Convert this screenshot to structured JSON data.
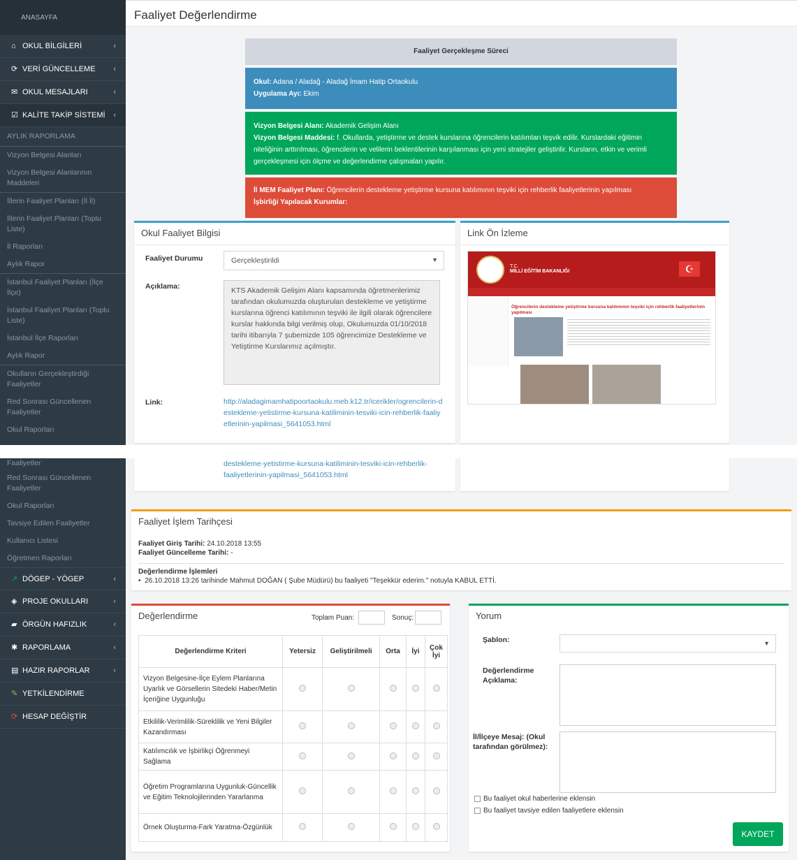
{
  "sidebar": {
    "top": "ANASAYFA",
    "menu": [
      "OKUL BİLGİLERİ",
      "VERİ GÜNCELLEME",
      "OKUL MESAJLARI",
      "KALİTE TAKİP SİSTEMİ"
    ],
    "subs": [
      "AYLIK RAPORLAMA",
      "Vizyon Belgesi Alanları",
      "Vizyon Belgesi Alanlarının Maddeleri",
      "İllerin Faaliyet Planları (İl İl)",
      "İllerin Faaliyet Planları (Toplu Liste)",
      "İl Raporları",
      "Aylık Rapor",
      "İstanbul Faaliyet Planları (İlçe İlçe)",
      "İstanbul Faaliyet Planları (Toplu Liste)",
      "İstanbul İlçe Raporları",
      "Aylık Rapor",
      "Okulların Gerçekleştirdiği Faaliyetler",
      "Red Sonrası Güncellenen Faaliyetler",
      "Okul Raporları"
    ],
    "subs2": [
      "Faaliyetler",
      "Red Sonrası Güncellenen Faaliyetler",
      "Okul Raporları",
      "Tavsiye Edilen Faaliyetler",
      "Kullanıcı Listesi",
      "Öğretmen Raporları"
    ],
    "menu2": [
      "DÖGEP - YÖGEP",
      "PROJE OKULLARI",
      "ÖRGÜN HAFIZLIK",
      "RAPORLAMA",
      "HAZIR RAPORLAR",
      "YETKİLENDİRME",
      "HESAP DEĞİŞTİR"
    ]
  },
  "page": {
    "title": "Faaliyet Değerlendirme"
  },
  "process": {
    "header": "Faaliyet Gerçekleşme Süreci",
    "okul_label": "Okul:",
    "okul": "Adana / Aladağ - Aladağ İmam Hatip Ortaokulu",
    "ay_label": "Uygulama Ayı:",
    "ay": "Ekim",
    "alan_label": "Vizyon Belgesi Alanı:",
    "alan": "Akademik Gelişim Alanı",
    "madde_label": "Vizyon Belgesi Maddesi:",
    "madde": "f. Okullarda, yetiştirme ve destek kurslarına öğrencilerin katılımları teşvik edilir. Kurslardaki eğitimin niteliğinin arttırılması, öğrencilerin ve velilerin beklentilerinin karşılanması için yeni stratejiler geliştirilir. Kursların, etkin ve verimli gerçekleşmesi için ölçme ve değerlendirme çalışmaları yapılır.",
    "plan_label": "İl MEM Faaliyet Planı:",
    "plan": "Öğrencilerin destekleme yetiştirme kursuna katılımının teşviki için rehberlik faaliyetlerinin yapılması",
    "kurum_label": "İşbirliği Yapılacak Kurumlar:"
  },
  "info": {
    "title": "Okul Faaliyet Bilgisi",
    "durum_label": "Faaliyet Durumu",
    "durum": "Gerçekleştirildi",
    "aciklama_label": "Açıklama:",
    "aciklama": "KTS Akademik Gelişim Alanı kapsamında öğretmenlerimiz tarafından okulumuzda oluşturulan destekleme ve yetiştirme kurslarına öğrenci katılımının teşviki ile ilgili olarak öğrencilere kurslar hakkında bilgi verilmiş olup, Okulumuzda 01/10/2018 tarihi itibarıyla 7 şubemizde 105 öğrencimize Destekleme ve Yetiştirme Kurslarımız açılmıştır.",
    "link_label": "Link:",
    "link": "http://aladagimamhatipoortaokulu.meb.k12.tr/icerikler/ogrencilerin-destekleme-yetistirme-kursuna-katiliminin-tesviki-icin-rehberlik-faaliyetlerinin-yapilmasi_5641053.html",
    "link_tail": "destekleme-yetistirme-kursuna-katiliminin-tesviki-icin-rehberlik-faaliyetlerinin-yapilmasi_5641053.html"
  },
  "preview": {
    "title": "Link Ön İzleme",
    "site_tc": "T.C.",
    "site_name": "MİLLİ EĞİTİM BAKANLIĞI",
    "headline": "Öğrencilerin destekleme yetiştirme kursuna katılımının teşviki için rehberlik faaliyetlerinin yapılması"
  },
  "history": {
    "title": "Faaliyet İşlem Tarihçesi",
    "giris_label": "Faaliyet Giriş Tarihi:",
    "giris": "24.10.2018 13:55",
    "guncel_label": "Faaliyet Güncelleme Tarihi:",
    "guncel": "-",
    "islem_label": "Değerlendirme İşlemleri",
    "islem": "26.10.2018 13:26 tarihinde Mahmut DOĞAN ( Şube Müdürü) bu faaliyeti \"Teşekkür ederim.\" notuyla KABUL ETTİ."
  },
  "eval": {
    "title": "Değerlendirme",
    "toplam": "Toplam Puan:",
    "sonuc": "Sonuç:",
    "headers": [
      "Değerlendirme Kriteri",
      "Yetersiz",
      "Geliştirilmeli",
      "Orta",
      "İyi",
      "Çok İyi"
    ],
    "criteria": [
      "Vizyon Belgesine-İlçe Eylem Planlarına Uyarlık ve Görsellerin Sitedeki Haber/Metin İçeriğine Uygunluğu",
      "Etkililik-Verimlilik-Süreklilik ve Yeni Bilgiler Kazandırması",
      "Katılımcılık ve İşbirlikçi Öğrenmeyi Sağlama",
      "Öğretim Programlarına Uygunluk-Güncellik ve Eğitim Teknolojilerinden Yararlanma",
      "Örnek Oluşturma-Fark Yaratma-Özgünlük"
    ]
  },
  "yorum": {
    "title": "Yorum",
    "sablon": "Şablon:",
    "aciklama": "Değerlendirme Açıklama:",
    "mesaj": "İl/İlçeye Mesaj: (Okul tarafından görülmez):",
    "chk1": "Bu faaliyet okul haberlerine eklensin",
    "chk2": "Bu faaliyet tavsiye edilen faaliyetlere eklensin",
    "save": "KAYDET"
  },
  "colors": {
    "blue": "#3c8dbc",
    "green": "#00a65a",
    "red": "#dd4b39",
    "gray": "#d2d6de"
  }
}
